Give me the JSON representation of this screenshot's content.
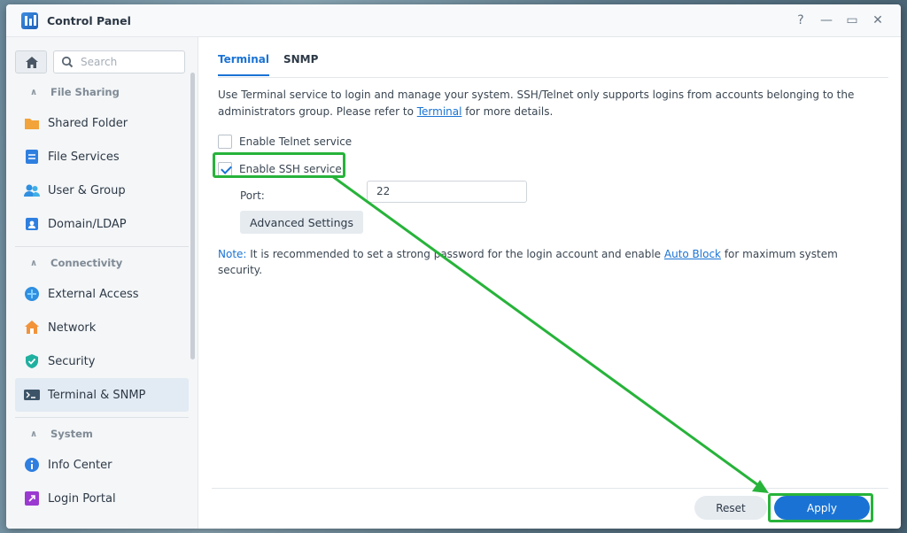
{
  "window": {
    "title": "Control Panel",
    "help_label": "?",
    "minimize_label": "—",
    "maximize_label": "▭",
    "close_label": "✕"
  },
  "search": {
    "placeholder": "Search",
    "value": ""
  },
  "sidebar": {
    "groups": [
      {
        "label": "File Sharing",
        "items": [
          "Shared Folder",
          "File Services",
          "User & Group",
          "Domain/LDAP"
        ]
      },
      {
        "label": "Connectivity",
        "items": [
          "External Access",
          "Network",
          "Security",
          "Terminal & SNMP"
        ]
      },
      {
        "label": "System",
        "items": [
          "Info Center",
          "Login Portal"
        ]
      }
    ],
    "active_item": "Terminal & SNMP"
  },
  "tabs": [
    {
      "label": "Terminal",
      "active": true
    },
    {
      "label": "SNMP",
      "active": false
    }
  ],
  "description": {
    "text1": "Use Terminal service to login and manage your system. SSH/Telnet only supports logins from accounts belonging to the administrators group. Please refer to ",
    "link": "Terminal",
    "text2": " for more details."
  },
  "telnet": {
    "label": "Enable Telnet service",
    "checked": false
  },
  "ssh": {
    "label": "Enable SSH service",
    "checked": true
  },
  "port": {
    "label": "Port:",
    "value": "22"
  },
  "advanced_button": "Advanced Settings",
  "note": {
    "prefix": "Note:",
    "text1": " It is recommended to set a strong password for the login account and enable ",
    "link": "Auto Block",
    "text2": " for maximum system security."
  },
  "footer": {
    "reset_label": "Reset",
    "apply_label": "Apply"
  },
  "colors": {
    "accent": "#1a73d4",
    "annotation": "#27b33a"
  }
}
